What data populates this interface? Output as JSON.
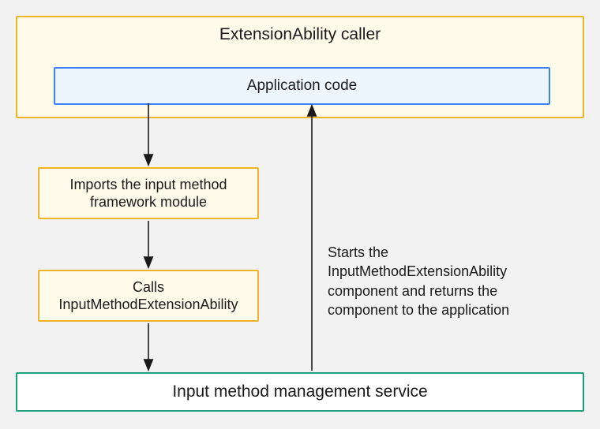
{
  "diagram": {
    "caller_title": "ExtensionAbility caller",
    "app_code_label": "Application code",
    "step_import": "Imports the input method framework module",
    "step_call": "Calls InputMethodExtensionAbility",
    "service_label": "Input method management service",
    "return_note": "Starts the InputMethodExtensionAbility component and returns the component to the application"
  }
}
